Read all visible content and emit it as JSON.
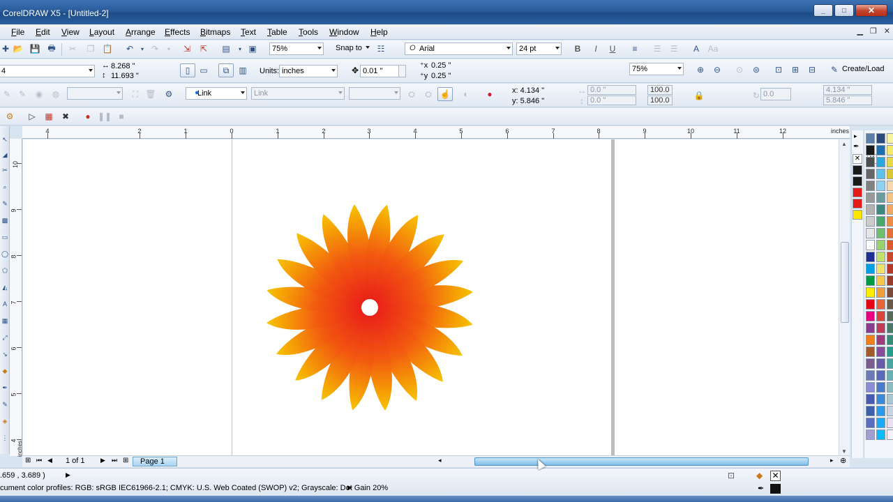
{
  "window": {
    "title": "CorelDRAW X5 - [Untitled-2]",
    "buttons": {
      "minimize": "_",
      "maximize": "□",
      "close": "✕"
    }
  },
  "menu": [
    "File",
    "Edit",
    "View",
    "Layout",
    "Arrange",
    "Effects",
    "Bitmaps",
    "Text",
    "Table",
    "Tools",
    "Window",
    "Help"
  ],
  "standard_toolbar": {
    "zoom": "75%",
    "snap_to": "Snap to",
    "font": "Arial",
    "font_size": "24 pt"
  },
  "property_bar": {
    "paper": "4",
    "width": "8.268 \"",
    "height": "11.693 \"",
    "units_label": "Units:",
    "units": "inches",
    "nudge": "0.01 \"",
    "dup_x": "0.25 \"",
    "dup_y": "0.25 \"",
    "zoom": "75%",
    "create_load": "Create/Load"
  },
  "object_bar": {
    "link": "Link",
    "link2": "Link",
    "x": "x: 4.134 \"",
    "y": "y: 5.846 \"",
    "w": "0.0 \"",
    "h": "0.0 \"",
    "scale_w": "100.0",
    "scale_h": "100.0",
    "angle": "0.0",
    "pos_x": "4.134 \"",
    "pos_y": "5.846 \""
  },
  "ruler": {
    "unit": "inches",
    "h_labels": [
      "4",
      "2",
      "1",
      "0",
      "1",
      "2",
      "3",
      "4",
      "5",
      "6",
      "7",
      "8",
      "9",
      "10",
      "11",
      "12"
    ],
    "v_labels": [
      "10",
      "9",
      "8",
      "7",
      "6",
      "5",
      "4"
    ],
    "v_unit": "inches"
  },
  "navigator": {
    "page_count": "1 of 1",
    "page_tab": "Page 1"
  },
  "status": {
    "coordinates": ".659 , 3.689 )",
    "profiles": "cument color profiles: RGB: sRGB IEC61966-2.1; CMYK: U.S. Web Coated (SWOP) v2; Grayscale: Dot Gain 20%"
  },
  "drawing": {
    "petals": 20,
    "colors": {
      "center": "#e8191a",
      "mid": "#f25a10",
      "tip": "#f7c400"
    }
  },
  "colors": {
    "document_palette": [
      "#1a1a1a",
      "#1a1a1a",
      "#e41b1b",
      "#e41b1b",
      "#ffe500"
    ],
    "palette_col1": [
      "#5b7fa6",
      "#1a1a1a",
      "#4d4d4d",
      "#666666",
      "#808080",
      "#999999",
      "#b3b3b3",
      "#cccccc",
      "#e6e6e6",
      "#ffffff",
      "#1d2f8f",
      "#00a0e3",
      "#009a44",
      "#ffed00",
      "#e30613",
      "#e5007e",
      "#8b3c8c",
      "#f07f1a",
      "#a05a2c",
      "#7a5c8e",
      "#6d7bb5",
      "#8c8cd4",
      "#4a5ab0",
      "#3f5fa8",
      "#5a6ec0",
      "#a0a0d0"
    ],
    "palette_col2": [
      "#2c4a7c",
      "#1c6fae",
      "#2aa7dc",
      "#5bc3ea",
      "#8dd3f1",
      "#6b9e9a",
      "#3e8b7d",
      "#4aa86b",
      "#6fbf6b",
      "#9ad36b",
      "#c2e06b",
      "#f2e36b",
      "#f5c64a",
      "#f39c3a",
      "#e8653a",
      "#d9453a",
      "#c23a5a",
      "#a13a7a",
      "#8a4a9a",
      "#6a5aaa",
      "#5a6aba",
      "#4a7aca",
      "#3a8ada",
      "#2a9aea",
      "#1aaafa",
      "#0abaff"
    ],
    "palette_col3": [
      "#f7f3a0",
      "#f2e86b",
      "#e8d94a",
      "#d9c73a",
      "#f5d7b0",
      "#f2c48a",
      "#eea964",
      "#e98d44",
      "#e37236",
      "#d95a2a",
      "#c9472a",
      "#b53a2a",
      "#9a3a2a",
      "#7a4a3a",
      "#6a5a4a",
      "#5a6a5a",
      "#4a7a6a",
      "#3a8a7a",
      "#2a9a8a",
      "#4aa4a0",
      "#6ab0b0",
      "#8abcc0",
      "#aac8d0",
      "#cad4e0",
      "#eae0f0",
      "#f8f0f8"
    ]
  }
}
